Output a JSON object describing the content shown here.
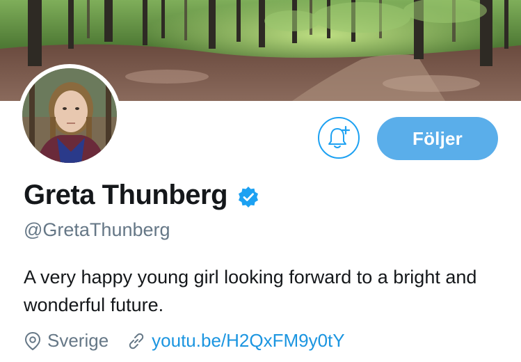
{
  "profile": {
    "display_name": "Greta Thunberg",
    "handle": "@GretaThunberg",
    "verified": true,
    "bio": "A very happy young girl looking forward to a bright and wonderful future.",
    "location": "Sverige",
    "website": "youtu.be/H2QxFM9y0tY"
  },
  "actions": {
    "follow_label": "Följer",
    "notification_icon": "bell-plus-icon"
  },
  "icons": {
    "location": "map-pin-icon",
    "link": "link-icon",
    "verified": "verified-badge-icon"
  },
  "colors": {
    "accent": "#1da1f2",
    "follow_button_bg": "#5aaeea",
    "link": "#1b95e0",
    "secondary_text": "#657786",
    "primary_text": "#14171a"
  }
}
